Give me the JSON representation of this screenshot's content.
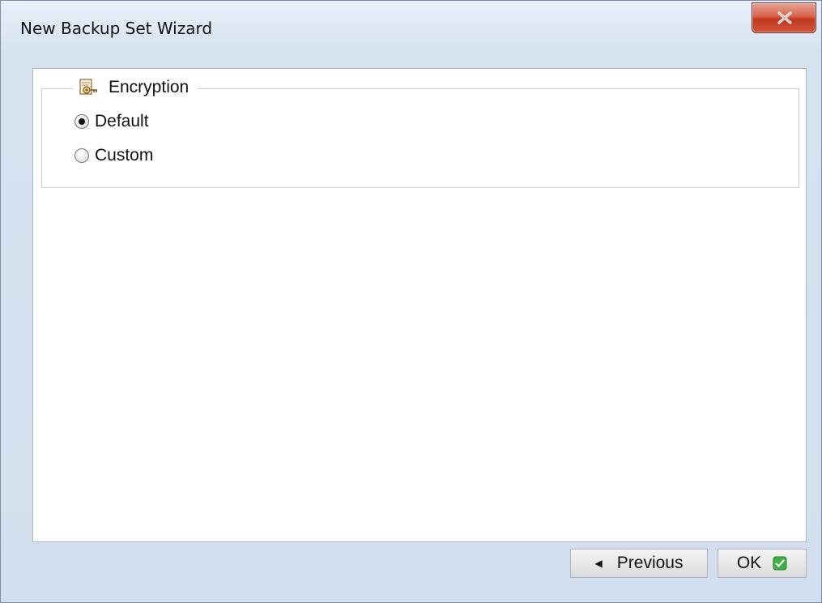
{
  "window": {
    "title": "New Backup Set Wizard",
    "close_label": "x"
  },
  "encryption": {
    "legend": "Encryption",
    "options": [
      {
        "label": "Default",
        "checked": true
      },
      {
        "label": "Custom",
        "checked": false
      }
    ]
  },
  "footer": {
    "previous_label": "Previous",
    "ok_label": "OK"
  },
  "icons": {
    "legend_icon": "key-certificate-icon",
    "previous_icon": "arrow-left-icon",
    "ok_icon": "green-check-icon",
    "close_icon": "close-icon"
  },
  "colors": {
    "close_button": "#c2361f",
    "ok_check": "#3cb043"
  }
}
